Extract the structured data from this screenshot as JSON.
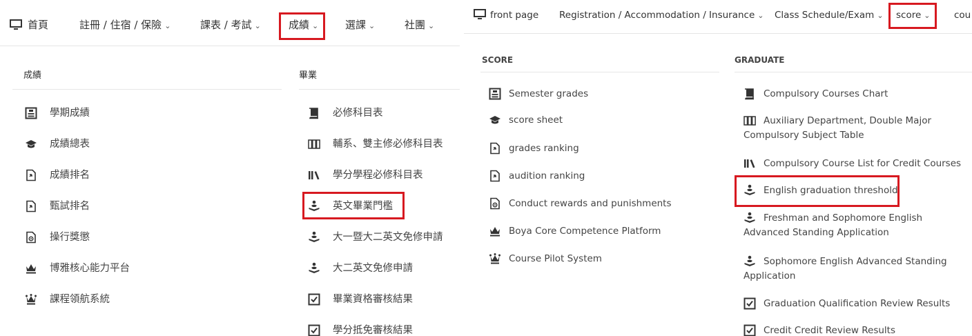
{
  "left": {
    "nav": [
      "首頁",
      "註冊 / 住宿 / 保險",
      "課表 / 考試",
      "成績",
      "選課",
      "社團"
    ],
    "score_header": "成績",
    "graduate_header": "畢業",
    "score_items": [
      "學期成績",
      "成績總表",
      "成績排名",
      "甄試排名",
      "操行獎懲",
      "博雅核心能力平台",
      "課程領航系統"
    ],
    "graduate_items": [
      "必修科目表",
      "輔系、雙主修必修科目表",
      "學分學程必修科目表",
      "英文畢業門檻",
      "大一暨大二英文免修申請",
      "大二英文免修申請",
      "畢業資格審核結果",
      "學分抵免審核結果"
    ]
  },
  "right": {
    "nav": [
      "front page",
      "Registration / Accommodation / Insurance",
      "Class Schedule/Exam",
      "score",
      "cou"
    ],
    "score_header": "SCORE",
    "graduate_header": "GRADUATE",
    "score_items": [
      "Semester grades",
      "score sheet",
      "grades ranking",
      "audition ranking",
      "Conduct rewards and punishments",
      "Boya Core Competence Platform",
      "Course Pilot System"
    ],
    "graduate_items": [
      "Compulsory Courses Chart",
      "Auxiliary Department, Double Major Compulsory Subject Table",
      "Compulsory Course List for Credit Courses",
      "English graduation threshold",
      "Freshman and Sophomore English Advanced Standing Application",
      "Sophomore English Advanced Standing Application",
      "Graduation Qualification Review Results",
      "Credit Credit Review Results"
    ]
  },
  "chevron": "⌄",
  "icons": {
    "nav": "monitor-icon",
    "score": [
      "list-box-icon",
      "graduation-cap-icon",
      "document-arrow-icon",
      "document-arrow-icon",
      "document-eye-icon",
      "crown-icon",
      "queen-icon"
    ],
    "graduate": [
      "book-icon",
      "three-books-icon",
      "library-icon",
      "person-reading-icon",
      "person-reading-icon",
      "person-reading-icon",
      "check-box-icon",
      "check-box-icon"
    ]
  },
  "accent": "#d71920"
}
